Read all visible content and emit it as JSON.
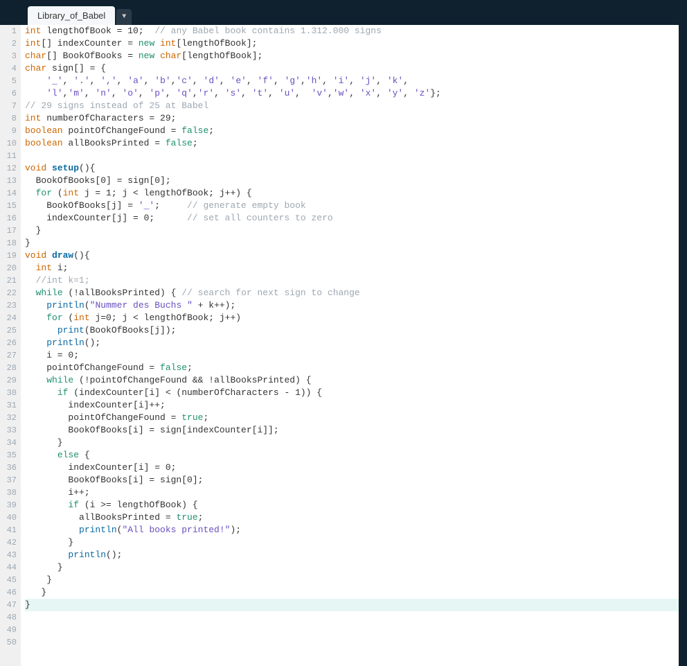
{
  "tab": {
    "title": "Library_of_Babel",
    "dropdown": "▼"
  },
  "gutter": {
    "start": 1,
    "end": 50
  },
  "current_line": 47,
  "lines": [
    [
      [
        "type",
        "int"
      ],
      [
        "plain",
        " lengthOfBook = 10;  "
      ],
      [
        "comment",
        "// any Babel book contains 1.312.000 signs"
      ]
    ],
    [
      [
        "type",
        "int"
      ],
      [
        "plain",
        "[] indexCounter = "
      ],
      [
        "keyword",
        "new"
      ],
      [
        "plain",
        " "
      ],
      [
        "type",
        "int"
      ],
      [
        "plain",
        "[lengthOfBook];"
      ]
    ],
    [
      [
        "type",
        "char"
      ],
      [
        "plain",
        "[] BookOfBooks = "
      ],
      [
        "keyword",
        "new"
      ],
      [
        "plain",
        " "
      ],
      [
        "type",
        "char"
      ],
      [
        "plain",
        "[lengthOfBook];"
      ]
    ],
    [
      [
        "type",
        "char"
      ],
      [
        "plain",
        " sign[] = {"
      ]
    ],
    [
      [
        "plain",
        "    "
      ],
      [
        "char",
        "'_'"
      ],
      [
        "plain",
        ", "
      ],
      [
        "char",
        "'.'"
      ],
      [
        "plain",
        ", "
      ],
      [
        "char",
        "','"
      ],
      [
        "plain",
        ", "
      ],
      [
        "char",
        "'a'"
      ],
      [
        "plain",
        ", "
      ],
      [
        "char",
        "'b'"
      ],
      [
        "plain",
        ","
      ],
      [
        "char",
        "'c'"
      ],
      [
        "plain",
        ", "
      ],
      [
        "char",
        "'d'"
      ],
      [
        "plain",
        ", "
      ],
      [
        "char",
        "'e'"
      ],
      [
        "plain",
        ", "
      ],
      [
        "char",
        "'f'"
      ],
      [
        "plain",
        ", "
      ],
      [
        "char",
        "'g'"
      ],
      [
        "plain",
        ","
      ],
      [
        "char",
        "'h'"
      ],
      [
        "plain",
        ", "
      ],
      [
        "char",
        "'i'"
      ],
      [
        "plain",
        ", "
      ],
      [
        "char",
        "'j'"
      ],
      [
        "plain",
        ", "
      ],
      [
        "char",
        "'k'"
      ],
      [
        "plain",
        ","
      ]
    ],
    [
      [
        "plain",
        "    "
      ],
      [
        "char",
        "'l'"
      ],
      [
        "plain",
        ","
      ],
      [
        "char",
        "'m'"
      ],
      [
        "plain",
        ", "
      ],
      [
        "char",
        "'n'"
      ],
      [
        "plain",
        ", "
      ],
      [
        "char",
        "'o'"
      ],
      [
        "plain",
        ", "
      ],
      [
        "char",
        "'p'"
      ],
      [
        "plain",
        ", "
      ],
      [
        "char",
        "'q'"
      ],
      [
        "plain",
        ","
      ],
      [
        "char",
        "'r'"
      ],
      [
        "plain",
        ", "
      ],
      [
        "char",
        "'s'"
      ],
      [
        "plain",
        ", "
      ],
      [
        "char",
        "'t'"
      ],
      [
        "plain",
        ", "
      ],
      [
        "char",
        "'u'"
      ],
      [
        "plain",
        ",  "
      ],
      [
        "char",
        "'v'"
      ],
      [
        "plain",
        ","
      ],
      [
        "char",
        "'w'"
      ],
      [
        "plain",
        ", "
      ],
      [
        "char",
        "'x'"
      ],
      [
        "plain",
        ", "
      ],
      [
        "char",
        "'y'"
      ],
      [
        "plain",
        ", "
      ],
      [
        "char",
        "'z'"
      ],
      [
        "plain",
        "};"
      ]
    ],
    [
      [
        "comment",
        "// 29 signs instead of 25 at Babel"
      ]
    ],
    [
      [
        "type",
        "int"
      ],
      [
        "plain",
        " numberOfCharacters = 29;"
      ]
    ],
    [
      [
        "type",
        "boolean"
      ],
      [
        "plain",
        " pointOfChangeFound = "
      ],
      [
        "keyword",
        "false"
      ],
      [
        "plain",
        ";"
      ]
    ],
    [
      [
        "type",
        "boolean"
      ],
      [
        "plain",
        " allBooksPrinted = "
      ],
      [
        "keyword",
        "false"
      ],
      [
        "plain",
        ";"
      ]
    ],
    [],
    [
      [
        "type",
        "void"
      ],
      [
        "plain",
        " "
      ],
      [
        "func",
        "setup"
      ],
      [
        "plain",
        "(){"
      ]
    ],
    [
      [
        "plain",
        "  BookOfBooks[0] = sign[0];"
      ]
    ],
    [
      [
        "plain",
        "  "
      ],
      [
        "keyword",
        "for"
      ],
      [
        "plain",
        " ("
      ],
      [
        "type",
        "int"
      ],
      [
        "plain",
        " j = 1; j < lengthOfBook; j++) {"
      ]
    ],
    [
      [
        "plain",
        "    BookOfBooks[j] = "
      ],
      [
        "char",
        "'_'"
      ],
      [
        "plain",
        ";     "
      ],
      [
        "comment",
        "// generate empty book"
      ]
    ],
    [
      [
        "plain",
        "    indexCounter[j] = 0;      "
      ],
      [
        "comment",
        "// set all counters to zero"
      ]
    ],
    [
      [
        "plain",
        "  }"
      ]
    ],
    [
      [
        "plain",
        "}"
      ]
    ],
    [
      [
        "type",
        "void"
      ],
      [
        "plain",
        " "
      ],
      [
        "func",
        "draw"
      ],
      [
        "plain",
        "(){"
      ]
    ],
    [
      [
        "plain",
        "  "
      ],
      [
        "type",
        "int"
      ],
      [
        "plain",
        " i;"
      ]
    ],
    [
      [
        "plain",
        "  "
      ],
      [
        "comment",
        "//int k=1;"
      ]
    ],
    [
      [
        "plain",
        "  "
      ],
      [
        "keyword",
        "while"
      ],
      [
        "plain",
        " (!allBooksPrinted) { "
      ],
      [
        "comment",
        "// search for next sign to change"
      ]
    ],
    [
      [
        "plain",
        "    "
      ],
      [
        "builtin",
        "println"
      ],
      [
        "plain",
        "("
      ],
      [
        "string",
        "\"Nummer des Buchs \""
      ],
      [
        "plain",
        " + k++);"
      ]
    ],
    [
      [
        "plain",
        "    "
      ],
      [
        "keyword",
        "for"
      ],
      [
        "plain",
        " ("
      ],
      [
        "type",
        "int"
      ],
      [
        "plain",
        " j=0; j < lengthOfBook; j++)"
      ]
    ],
    [
      [
        "plain",
        "      "
      ],
      [
        "builtin",
        "print"
      ],
      [
        "plain",
        "(BookOfBooks[j]);"
      ]
    ],
    [
      [
        "plain",
        "    "
      ],
      [
        "builtin",
        "println"
      ],
      [
        "plain",
        "();"
      ]
    ],
    [
      [
        "plain",
        "    i = 0;"
      ]
    ],
    [
      [
        "plain",
        "    pointOfChangeFound = "
      ],
      [
        "keyword",
        "false"
      ],
      [
        "plain",
        ";"
      ]
    ],
    [
      [
        "plain",
        "    "
      ],
      [
        "keyword",
        "while"
      ],
      [
        "plain",
        " (!pointOfChangeFound && !allBooksPrinted) {"
      ]
    ],
    [
      [
        "plain",
        "      "
      ],
      [
        "keyword",
        "if"
      ],
      [
        "plain",
        " (indexCounter[i] < (numberOfCharacters - 1)) {"
      ]
    ],
    [
      [
        "plain",
        "        indexCounter[i]++;"
      ]
    ],
    [
      [
        "plain",
        "        pointOfChangeFound = "
      ],
      [
        "keyword",
        "true"
      ],
      [
        "plain",
        ";"
      ]
    ],
    [
      [
        "plain",
        "        BookOfBooks[i] = sign[indexCounter[i]];"
      ]
    ],
    [
      [
        "plain",
        "      }"
      ]
    ],
    [
      [
        "plain",
        "      "
      ],
      [
        "keyword",
        "else"
      ],
      [
        "plain",
        " {"
      ]
    ],
    [
      [
        "plain",
        "        indexCounter[i] = 0;"
      ]
    ],
    [
      [
        "plain",
        "        BookOfBooks[i] = sign[0];"
      ]
    ],
    [
      [
        "plain",
        "        i++;"
      ]
    ],
    [
      [
        "plain",
        "        "
      ],
      [
        "keyword",
        "if"
      ],
      [
        "plain",
        " (i >= lengthOfBook) {"
      ]
    ],
    [
      [
        "plain",
        "          allBooksPrinted = "
      ],
      [
        "keyword",
        "true"
      ],
      [
        "plain",
        ";"
      ]
    ],
    [
      [
        "plain",
        "          "
      ],
      [
        "builtin",
        "println"
      ],
      [
        "plain",
        "("
      ],
      [
        "string",
        "\"All books printed!\""
      ],
      [
        "plain",
        ");"
      ]
    ],
    [
      [
        "plain",
        "        }"
      ]
    ],
    [
      [
        "plain",
        "        "
      ],
      [
        "builtin",
        "println"
      ],
      [
        "plain",
        "();"
      ]
    ],
    [
      [
        "plain",
        "      }"
      ]
    ],
    [
      [
        "plain",
        "    }"
      ]
    ],
    [
      [
        "plain",
        "   }"
      ]
    ],
    [
      [
        "plain",
        "}"
      ]
    ]
  ]
}
